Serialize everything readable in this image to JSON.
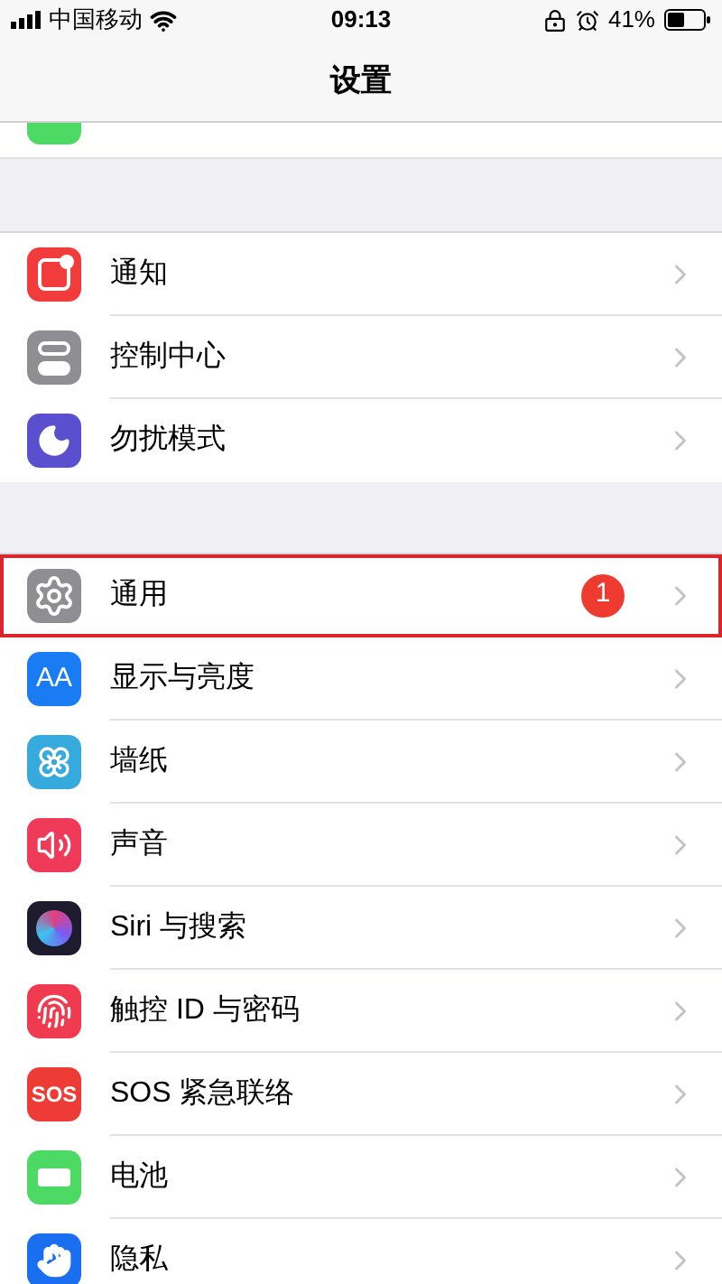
{
  "status_bar": {
    "carrier": "中国移动",
    "time": "09:13",
    "battery_percent": "41%"
  },
  "nav_bar": {
    "title": "设置"
  },
  "sections": [
    {
      "rows": [
        {
          "kind": "notifications",
          "label": "通知",
          "highlighted": false
        },
        {
          "kind": "control",
          "label": "控制中心",
          "highlighted": false
        },
        {
          "kind": "dnd",
          "label": "勿扰模式",
          "highlighted": false
        }
      ]
    },
    {
      "rows": [
        {
          "kind": "general",
          "label": "通用",
          "badge": "1",
          "highlighted": true
        },
        {
          "kind": "display",
          "label": "显示与亮度",
          "icon_text": "AA",
          "highlighted": false
        },
        {
          "kind": "wallpaper",
          "label": "墙纸",
          "highlighted": false
        },
        {
          "kind": "sound",
          "label": "声音",
          "highlighted": false
        },
        {
          "kind": "siri",
          "label": "Siri 与搜索",
          "highlighted": false
        },
        {
          "kind": "touchid",
          "label": "触控 ID 与密码",
          "highlighted": false
        },
        {
          "kind": "sos",
          "label": "SOS 紧急联络",
          "icon_text": "SOS",
          "highlighted": false
        },
        {
          "kind": "battery",
          "label": "电池",
          "highlighted": false
        },
        {
          "kind": "privacy",
          "label": "隐私",
          "highlighted": false
        }
      ]
    }
  ]
}
